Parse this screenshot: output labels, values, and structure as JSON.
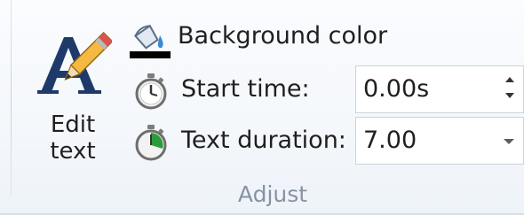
{
  "edit_text": {
    "label": "Edit\ntext",
    "icon": "edit-text-icon"
  },
  "background_color": {
    "label": "Background color",
    "icon": "fill-bucket-icon",
    "swatch_color": "#000000"
  },
  "start_time": {
    "label": "Start time:",
    "value": "0.00s",
    "icon": "stopwatch-icon"
  },
  "text_duration": {
    "label": "Text duration:",
    "value": "7.00",
    "icon": "stopwatch-play-icon"
  },
  "group": {
    "label": "Adjust"
  },
  "colors": {
    "accent_green": "#2e9b3a",
    "group_label": "#8793a3"
  }
}
